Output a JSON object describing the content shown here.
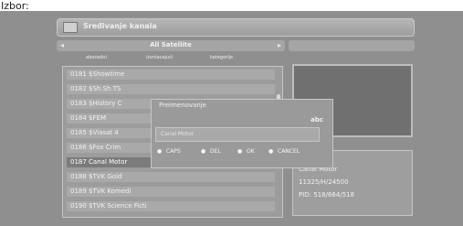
{
  "top_label": "Izbor:",
  "title_bar": {
    "title": "Sređivanje kanala",
    "icon": "tv-list-icon"
  },
  "tabs": {
    "left_arrow": "◂",
    "label": "All Satellite",
    "right_arrow": "▸"
  },
  "subheaders": [
    "abecedni",
    "izvršavajući",
    "kategorije"
  ],
  "channels": [
    "0181 $Showtime",
    "0182 $Sh.Sh.TS",
    "0183 $History C",
    "0184 $FEM",
    "0185 $Viasat 4",
    "0186 $Fox Crim",
    "0187 Canal Motor",
    "0188 $TVK Gold",
    "0189 $TVK Komedi",
    "0190 $TVK Science Ficti"
  ],
  "selected_index": 6,
  "info": {
    "name": "Canal Motor",
    "freq": "11325/H/24500",
    "pid": "PID: 518/664/518"
  },
  "dialog": {
    "title": "Preimenovanje",
    "mode": "abc",
    "input_value": "Canal Motor",
    "keys": [
      {
        "symbol": "●",
        "label": "CAPS"
      },
      {
        "symbol": "●",
        "label": "DEL"
      },
      {
        "symbol": "●",
        "label": "OK"
      },
      {
        "symbol": "●",
        "label": "CANCEL"
      }
    ]
  }
}
